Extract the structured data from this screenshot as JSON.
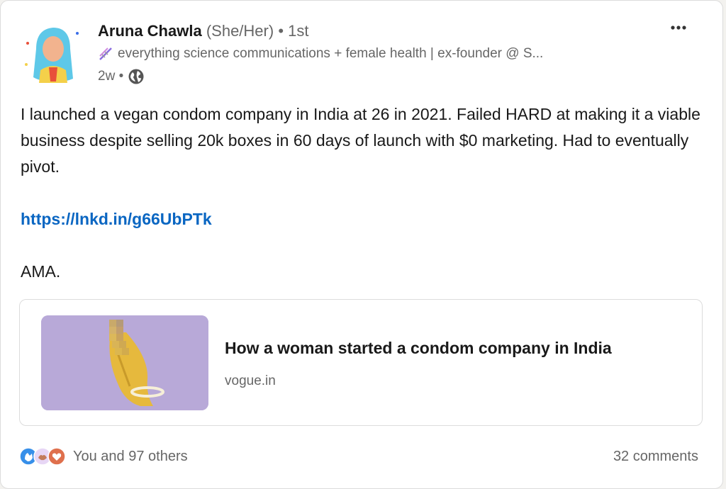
{
  "author": {
    "name": "Aruna Chawla",
    "pronouns": "(She/Her)",
    "connection": "• 1st",
    "headline": "everything science communications + female health | ex-founder @ S...",
    "time": "2w •"
  },
  "icons": {
    "more": "more-options-icon",
    "headline_emoji": "dna-icon",
    "visibility": "globe-icon"
  },
  "post": {
    "text": "I launched a vegan condom company in India at 26 in 2021. Failed HARD at making it a viable business despite selling 20k boxes in 60 days of launch with $0 marketing. Had to eventually pivot.",
    "link": "https://lnkd.in/g66UbPTk",
    "closing": "AMA."
  },
  "preview": {
    "title": "How a woman started a condom company in India",
    "source": "vogue.in"
  },
  "social": {
    "reactions_text": "You and 97 others",
    "comments_text": "32 comments"
  },
  "colors": {
    "link": "#0a66c2",
    "secondary_text": "#666666",
    "thumbnail_bg": "#b6a6d6"
  }
}
